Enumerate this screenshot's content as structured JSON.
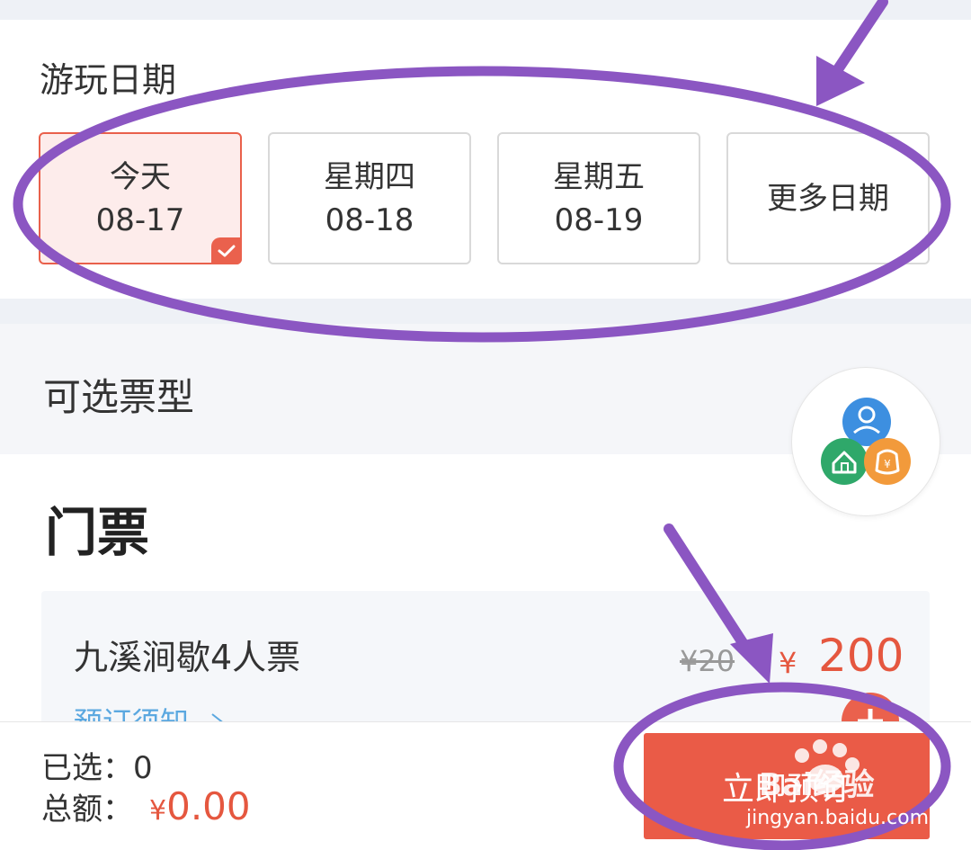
{
  "date_section": {
    "title": "游玩日期",
    "dates": [
      {
        "day": "今天",
        "date": "08-17",
        "selected": true
      },
      {
        "day": "星期四",
        "date": "08-18",
        "selected": false
      },
      {
        "day": "星期五",
        "date": "08-19",
        "selected": false
      }
    ],
    "more_label": "更多日期"
  },
  "ticket_type": {
    "title": "可选票型"
  },
  "ticket_group": {
    "title": "门票",
    "item": {
      "name": "九溪涧歇4人票",
      "old_price": "¥20",
      "price_symbol": "¥",
      "price": "200",
      "notice": "预订须知"
    }
  },
  "bottom_bar": {
    "selected_label": "已选：",
    "selected_count": "0",
    "total_label": "总额：",
    "total_symbol": "¥",
    "total_amount": "0.00",
    "buy_label": "立即预订"
  },
  "watermark": {
    "text": "Bai经验",
    "url": "jingyan.baidu.com"
  },
  "colors": {
    "accent": "#ea5b47",
    "price": "#e5573f",
    "link": "#5ba8e0",
    "annotation": "#8b56c2",
    "section_bg": "#eef1f6"
  },
  "icons": {
    "check": "check-icon",
    "float_button": "services-icon",
    "add": "plus-icon",
    "chevron": "chevron-right-icon"
  }
}
